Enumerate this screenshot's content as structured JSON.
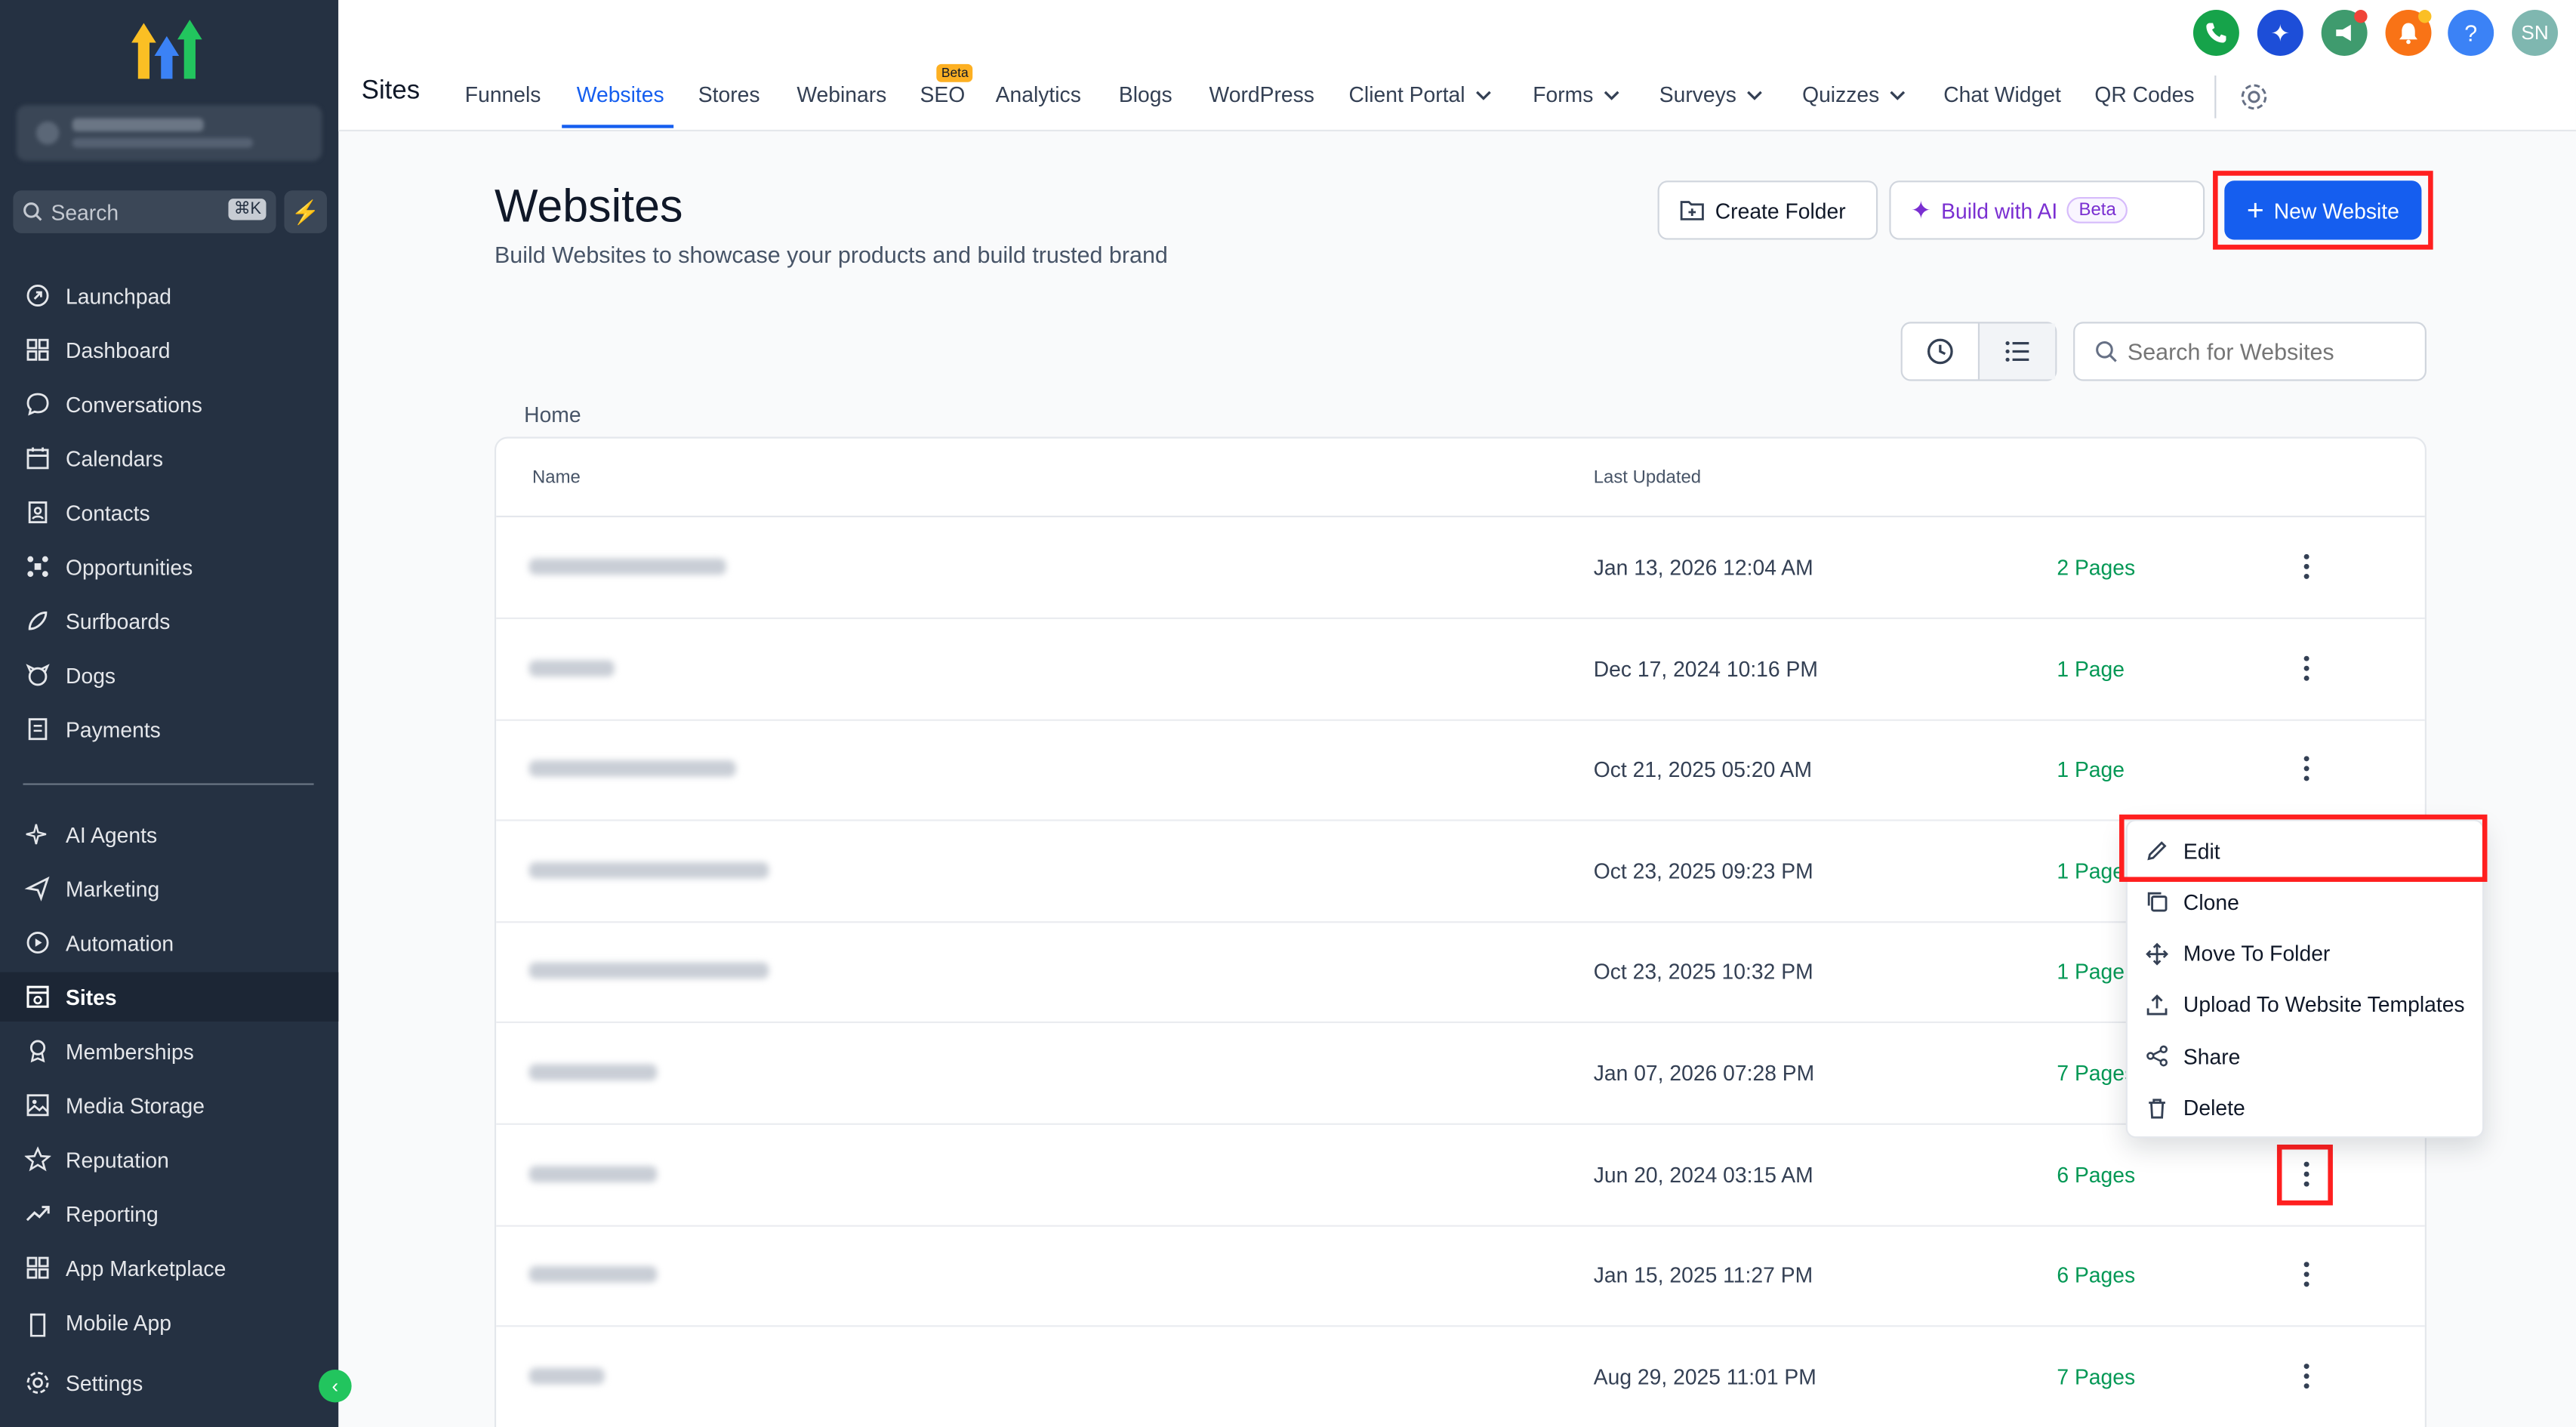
{
  "sidebar": {
    "search_label": "Search",
    "search_shortcut": "⌘K",
    "items": [
      {
        "label": "Launchpad",
        "icon": "launchpad-icon"
      },
      {
        "label": "Dashboard",
        "icon": "dashboard-icon"
      },
      {
        "label": "Conversations",
        "icon": "chat-icon"
      },
      {
        "label": "Calendars",
        "icon": "calendar-icon"
      },
      {
        "label": "Contacts",
        "icon": "contacts-icon"
      },
      {
        "label": "Opportunities",
        "icon": "opportunities-icon"
      },
      {
        "label": "Surfboards",
        "icon": "surfboard-icon"
      },
      {
        "label": "Dogs",
        "icon": "dog-icon"
      },
      {
        "label": "Payments",
        "icon": "payments-icon"
      },
      {
        "label": "AI Agents",
        "icon": "sparkle-icon"
      },
      {
        "label": "Marketing",
        "icon": "send-icon"
      },
      {
        "label": "Automation",
        "icon": "automation-icon"
      },
      {
        "label": "Sites",
        "icon": "sites-icon"
      },
      {
        "label": "Memberships",
        "icon": "memberships-icon"
      },
      {
        "label": "Media Storage",
        "icon": "image-icon"
      },
      {
        "label": "Reputation",
        "icon": "star-icon"
      },
      {
        "label": "Reporting",
        "icon": "trend-icon"
      },
      {
        "label": "App Marketplace",
        "icon": "grid-icon"
      },
      {
        "label": "Mobile App",
        "icon": "mobile-icon"
      }
    ],
    "settings_label": "Settings",
    "active_item": "Sites"
  },
  "topnav": {
    "title": "Sites",
    "tabs": [
      {
        "label": "Funnels"
      },
      {
        "label": "Websites"
      },
      {
        "label": "Stores"
      },
      {
        "label": "Webinars"
      },
      {
        "label": "SEO"
      },
      {
        "label": "Analytics"
      },
      {
        "label": "Blogs"
      },
      {
        "label": "WordPress"
      },
      {
        "label": "Client Portal"
      },
      {
        "label": "Forms"
      },
      {
        "label": "Surveys"
      },
      {
        "label": "Quizzes"
      },
      {
        "label": "Chat Widget"
      },
      {
        "label": "QR Codes"
      }
    ],
    "active_tab": "Websites",
    "seo_badge": "Beta",
    "user_initials": "SN",
    "help_glyph": "?"
  },
  "main": {
    "title": "Websites",
    "subtitle": "Build Websites to showcase your products and build trusted brand",
    "create_folder_label": "Create Folder",
    "build_ai_label": "Build with AI",
    "build_ai_badge": "Beta",
    "new_website_label": "New Website",
    "search_placeholder": "Search for Websites",
    "breadcrumb": "Home",
    "columns": {
      "name": "Name",
      "last_updated": "Last Updated"
    },
    "rows": [
      {
        "date": "Jan 13, 2026 12:04 AM",
        "pages": "2 Pages"
      },
      {
        "date": "Dec 17, 2024 10:16 PM",
        "pages": "1 Page"
      },
      {
        "date": "Oct 21, 2025 05:20 AM",
        "pages": "1 Page"
      },
      {
        "date": "Oct 23, 2025 09:23 PM",
        "pages": "1 Page"
      },
      {
        "date": "Oct 23, 2025 10:32 PM",
        "pages": "1 Page"
      },
      {
        "date": "Jan 07, 2026 07:28 PM",
        "pages": "7 Pages"
      },
      {
        "date": "Jun 20, 2024 03:15 AM",
        "pages": "6 Pages"
      },
      {
        "date": "Jan 15, 2025 11:27 PM",
        "pages": "6 Pages"
      },
      {
        "date": "Aug 29, 2025 11:01 PM",
        "pages": "7 Pages"
      }
    ]
  },
  "row_menu": {
    "items": [
      {
        "label": "Edit",
        "icon": "pencil-icon"
      },
      {
        "label": "Clone",
        "icon": "copy-icon"
      },
      {
        "label": "Move To Folder",
        "icon": "move-icon"
      },
      {
        "label": "Upload To Website Templates",
        "icon": "upload-icon"
      },
      {
        "label": "Share",
        "icon": "share-icon"
      },
      {
        "label": "Delete",
        "icon": "trash-icon"
      }
    ]
  },
  "colors": {
    "sidebar_bg": "#253142",
    "primary": "#155eef",
    "pages_green": "#039855",
    "highlight_red": "#ff1f1f"
  }
}
